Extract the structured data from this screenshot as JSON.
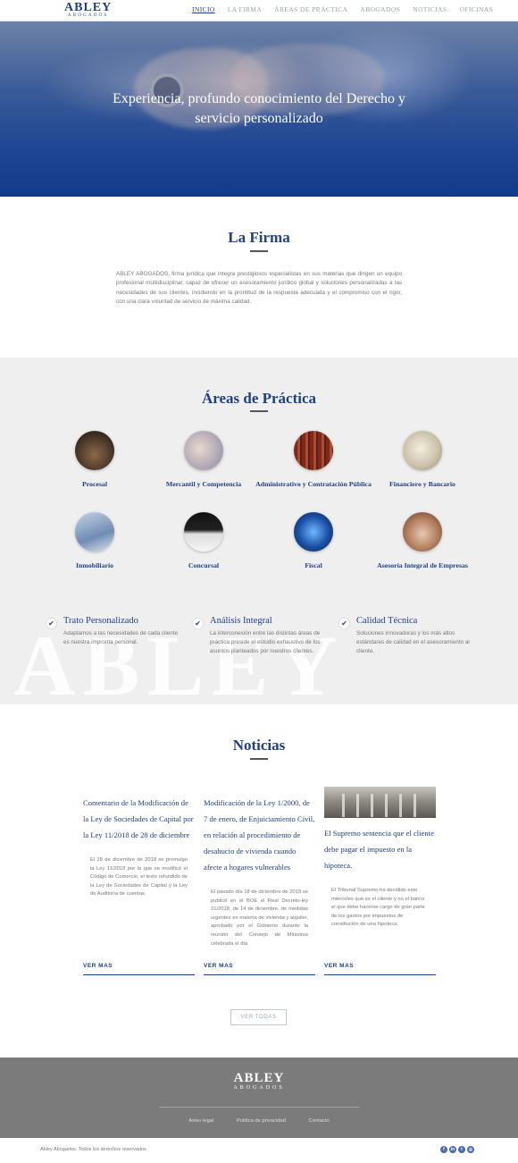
{
  "header": {
    "logo": {
      "main": "ABLEY",
      "sub": "ABOGADOS"
    },
    "nav": [
      "INICIO",
      "LA FIRMA",
      "ÁREAS DE PRÁCTICA",
      "ABOGADOS",
      "NOTICIAS",
      "OFICINAS"
    ],
    "active": "INICIO"
  },
  "hero": {
    "headline": "Experiencia, profundo conocimiento del Derecho y servicio personalizado"
  },
  "firma": {
    "title": "La Firma",
    "text": "ABLEY ABOGADOS, firma jurídica que integra prestigiosos especialistas en sus materias que dirigen un equipo profesional multidisciplinar, capaz de ofrecer un asesoramiento jurídico global y soluciones personalizadas a las necesidades de sus clientes, incidiendo en la prontitud de la respuesta adecuada y el compromiso con el rigor, con una clara voluntad de servicio de máxima calidad."
  },
  "areas": {
    "title": "Áreas de Práctica",
    "items": [
      {
        "label": "Procesal",
        "icon": "gavel-image"
      },
      {
        "label": "Mercantil y Competencia",
        "icon": "handshake-image"
      },
      {
        "label": "Administrativo y Contratación Pública",
        "icon": "books-image"
      },
      {
        "label": "Financiero y Bancario",
        "icon": "column-image"
      },
      {
        "label": "Inmobiliario",
        "icon": "building-image"
      },
      {
        "label": "Concursal",
        "icon": "piano-image"
      },
      {
        "label": "Fiscal",
        "icon": "network-image"
      },
      {
        "label": "Asesoría Integral de Empresas",
        "icon": "writing-image"
      }
    ],
    "watermark": "ABLEY",
    "features": [
      {
        "title": "Trato Personalizado",
        "text": "Adaptamos a las necesidades de cada cliente es nuestra impronta personal."
      },
      {
        "title": "Análisis Integral",
        "text": "La interconexión entre las distintas áreas de práctica preside el estudio exhaustivo de los asuntos planteados por nuestros clientes."
      },
      {
        "title": "Calidad Técnica",
        "text": "Soluciones innovadoras y los más altos estándares de calidad en el asesoramiento al cliente."
      }
    ]
  },
  "noticias": {
    "title": "Noticias",
    "items": [
      {
        "title": "Comentario de la Modificación de la Ley de Sociedades de Capital por la Ley 11/2018 de 28 de diciembre",
        "text": "El 28 de diciembre de 2018 se promulgo la Ley 11/2018 por la que se modificó el Código de Comercio, el texto refundido de la Ley de Sociedades de Capital y la Ley de Auditoría de cuentas.",
        "more": "VER MAS"
      },
      {
        "title": "Modificación de la Ley 1/2000, de 7 de enero, de Enjuiciamiento Civil, en relación al procedimiento de desahucio de vivienda cuando afecte a hogares vulnerables",
        "text": "El pasado día 18 de diciembre de 2018 se publicó en el BOE el Real Decreto-ley 21/2018, de 14 de diciembre, de medidas urgentes en materia de vivienda y alquiler, aprobado por el Gobierno durante la reunión del Consejo de Ministros celebrada el día",
        "more": "VER MAS"
      },
      {
        "title": "El Supremo sentencia que el cliente debe pagar el impuesto en la hipoteca.",
        "text": "El Tribunal Supremo ha decidido este miércoles que es el cliente y no el banco el que debe hacerse cargo de gran parte de los gastos por impuestos de constitución de una hipoteca.",
        "more": "VER MAS"
      }
    ],
    "all_button": "VER TODAS"
  },
  "footer": {
    "logo": {
      "main": "ABLEY",
      "sub": "ABOGADOS"
    },
    "links": [
      "Aviso legal",
      "Política de privacidad",
      "Contacto"
    ],
    "copyright": "Abley Abogados. Todos los derechos reservados",
    "social": [
      "facebook-icon",
      "linkedin-icon",
      "twitter-icon",
      "instagram-icon"
    ]
  }
}
